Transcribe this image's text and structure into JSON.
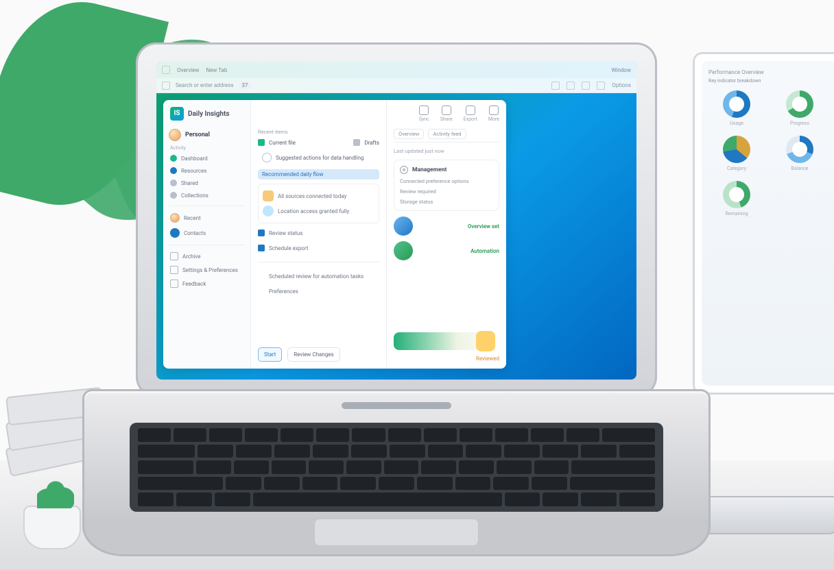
{
  "topbar": {
    "tab_a": "Overview",
    "tab_b": "New Tab",
    "right": "Window"
  },
  "addressbar": {
    "url_text": "Search or enter address",
    "badge": "37",
    "tool_r": "Options"
  },
  "app": {
    "title": "Daily Insights",
    "tool_1": "Sync",
    "tool_2": "Share",
    "tool_3": "Export",
    "tool_4": "More"
  },
  "sidebar": {
    "heading": "Personal",
    "group_a": "Activity",
    "item_a1": "Dashboard",
    "item_a2": "Resources",
    "item_a3": "Shared",
    "item_a4": "Collections",
    "item_b1": "Recent",
    "item_b2": "Contacts",
    "item_c1": "Archive",
    "item_c2": "Settings & Preferences",
    "item_c3": "Feedback"
  },
  "mid": {
    "sub": "Recent items",
    "chip_a": "Current file",
    "chip_b": "Drafts",
    "title_a": "Suggested actions for data handling",
    "blue": "Recommended daily flow",
    "card_line1": "All sources connected today",
    "card_line2": "Location access granted fully",
    "list_1": "Review status",
    "list_2": "Schedule export",
    "list_3": "Scheduled review for automation tasks",
    "list_4": "Preferences",
    "btn_primary": "Start",
    "btn_secondary": "Review Changes"
  },
  "right": {
    "tab_1": "Overview",
    "tab_2": "Activity feed",
    "sub": "Last updated just now",
    "card_title": "Management",
    "k1": "Connected preference options",
    "k2": "Review required",
    "k3": "Storage status",
    "feat_1": "Overview set",
    "feat_2": "Automation",
    "orange": "Reviewed"
  },
  "monitor": {
    "head": "Performance Overview",
    "sub": "Key indicator breakdown",
    "w1": "Usage",
    "w2": "Progress",
    "w3": "Category",
    "w4": "Balance",
    "w5": "Remaining"
  }
}
